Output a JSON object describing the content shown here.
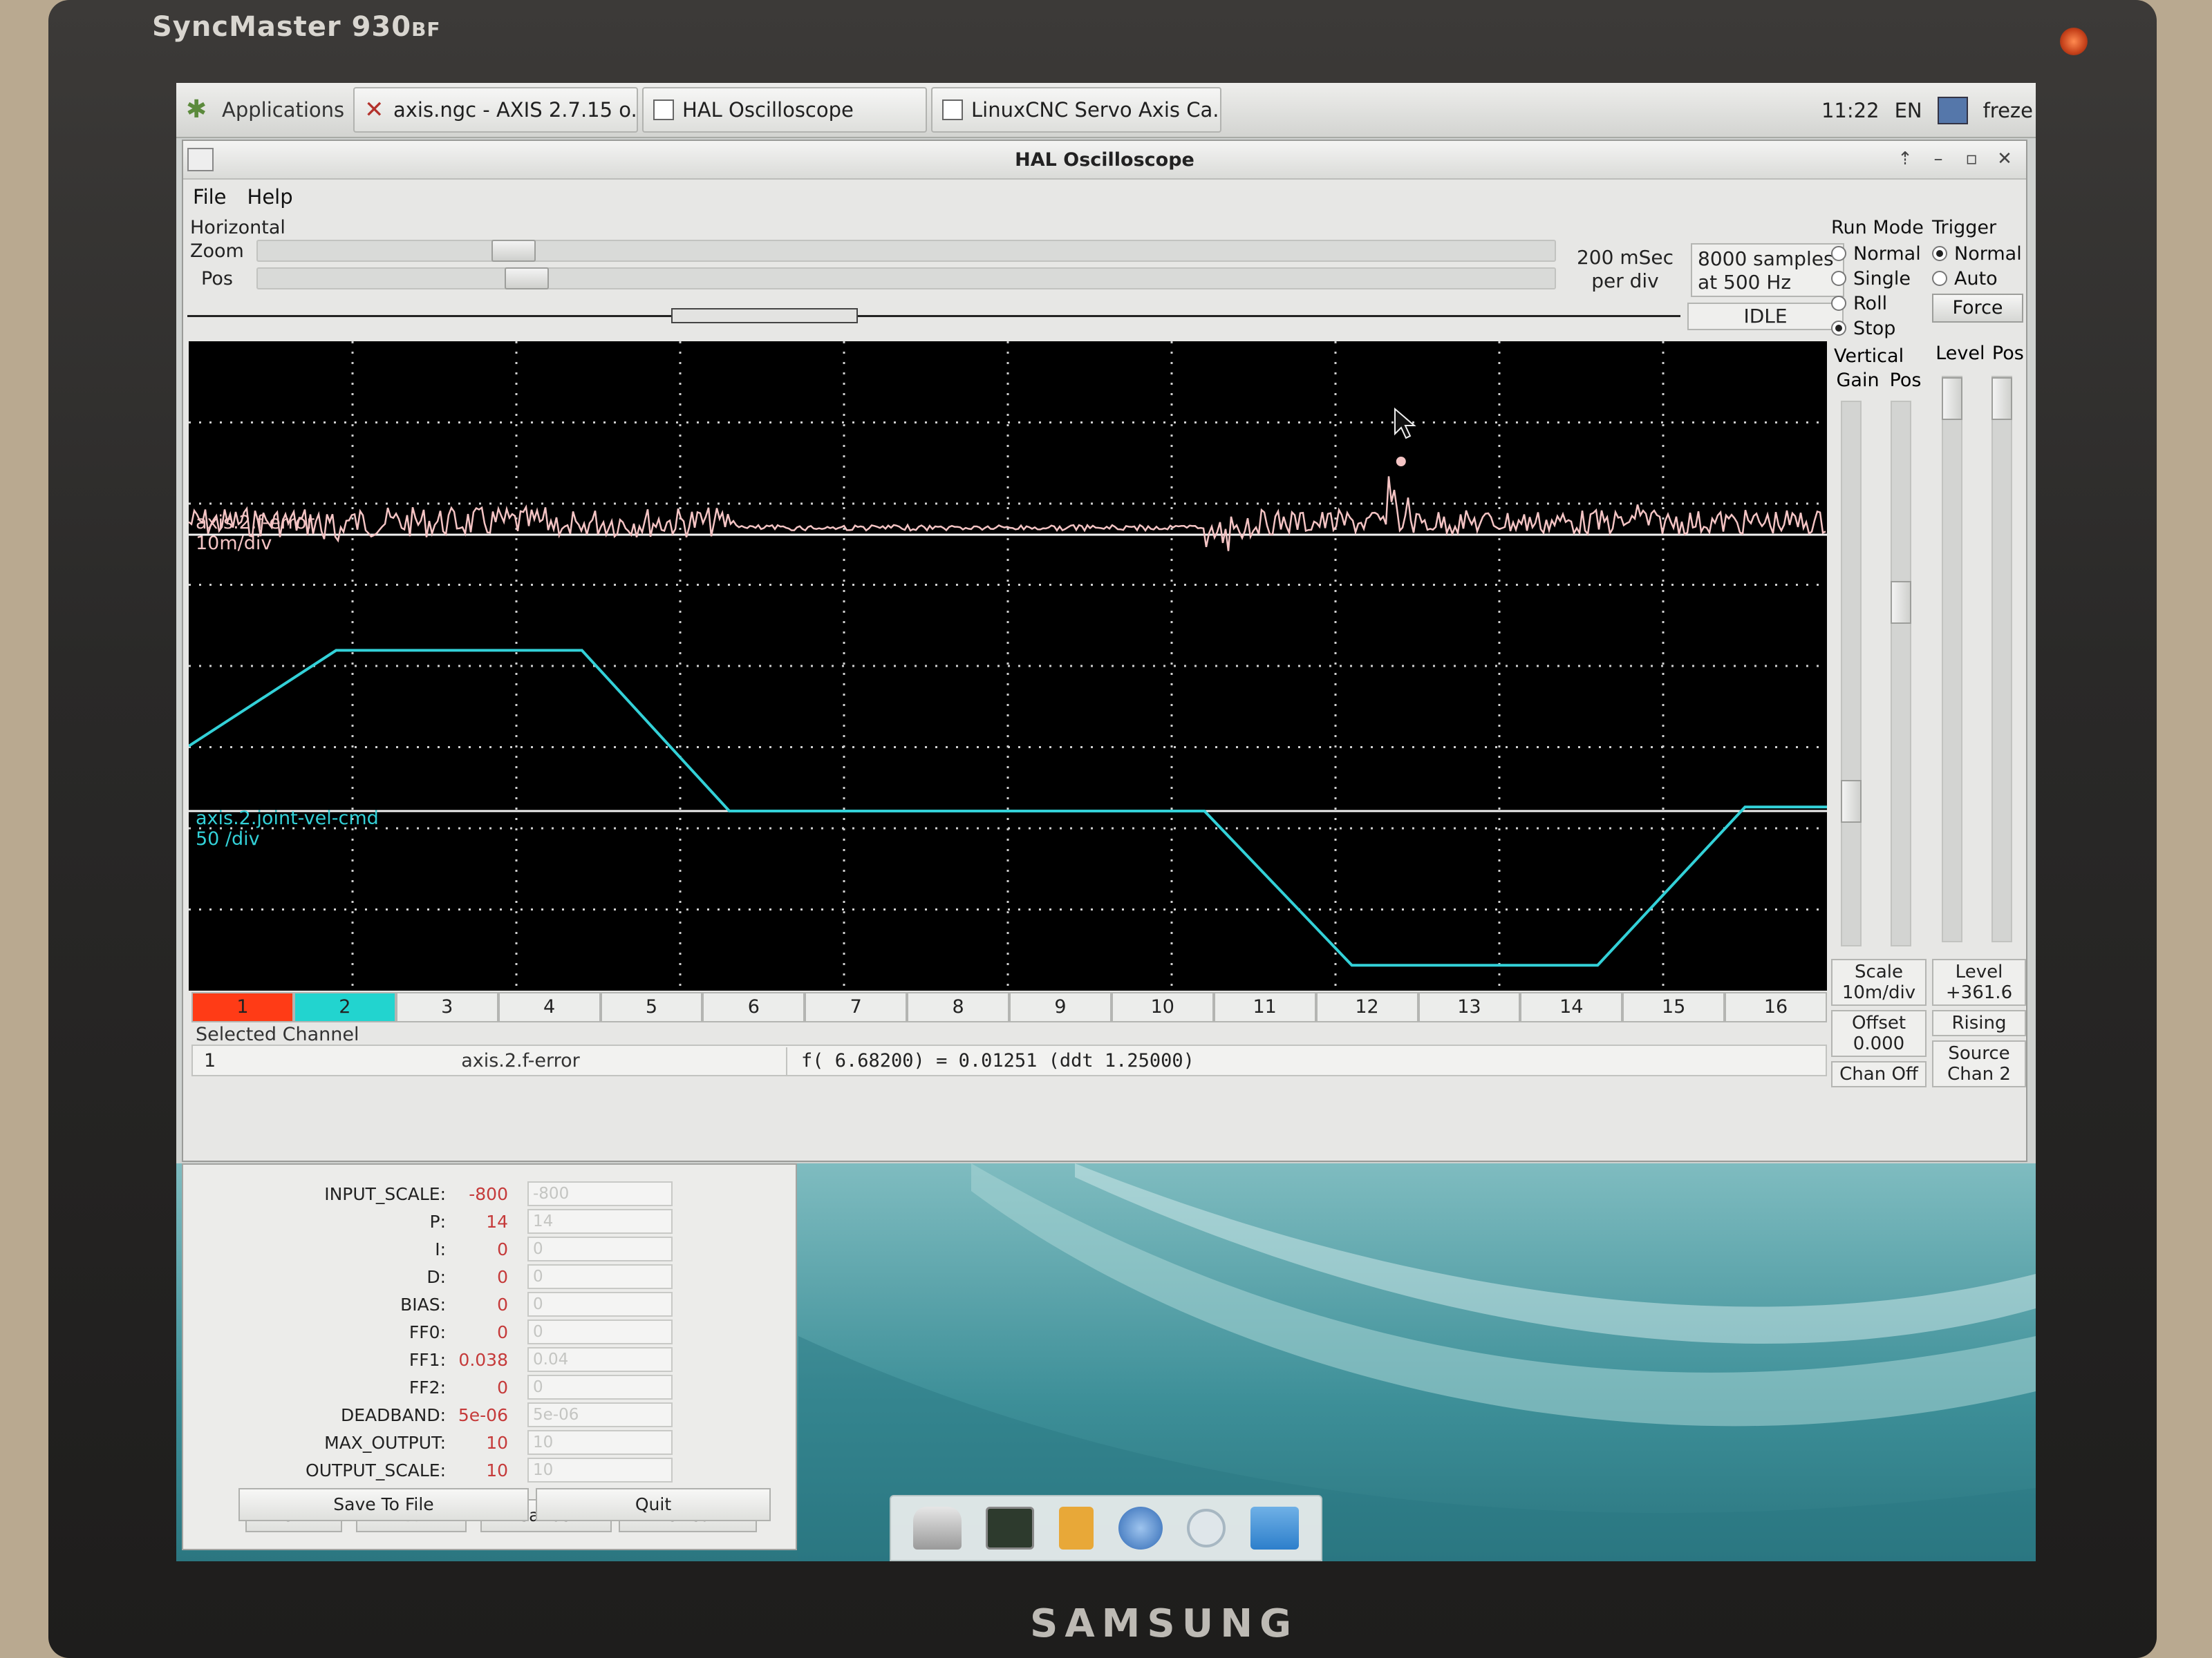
{
  "monitor": {
    "model": "SyncMaster 930",
    "model_suffix": "BF",
    "brand": "SAMSUNG"
  },
  "taskbar": {
    "apps_label": "Applications",
    "tasks": [
      "axis.ngc - AXIS 2.7.15 o...",
      "HAL Oscilloscope",
      "LinuxCNC Servo Axis Ca..."
    ],
    "clock": "11:22",
    "lang": "EN",
    "user": "freze"
  },
  "window": {
    "title": "HAL Oscilloscope",
    "menu": {
      "file": "File",
      "help": "Help"
    }
  },
  "horizontal": {
    "title": "Horizontal",
    "zoom_label": "Zoom",
    "pos_label": "Pos",
    "zoom_fraction": 0.18,
    "pos_fraction": 0.19,
    "per_div_line1": "200 mSec",
    "per_div_line2": "per div",
    "samples_line1": "8000 samples",
    "samples_line2": "at 500 Hz",
    "state": "IDLE"
  },
  "run_mode": {
    "title": "Run Mode",
    "options": [
      "Normal",
      "Single",
      "Roll",
      "Stop"
    ],
    "selected": "Stop"
  },
  "trigger": {
    "title": "Trigger",
    "options": [
      "Normal",
      "Auto"
    ],
    "selected": "Normal",
    "force": "Force",
    "level_label": "Level",
    "pos_label": "Pos"
  },
  "vertical": {
    "title": "Vertical",
    "gain_label": "Gain",
    "pos_label": "Pos",
    "gain_fraction": 0.24,
    "pos_fraction": 0.64
  },
  "vertical_bottom": {
    "scale_label": "Scale",
    "scale_value": "10m/div",
    "offset_label": "Offset",
    "offset_value": "0.000",
    "chan_off": "Chan Off"
  },
  "trigger_bottom": {
    "level_label": "Level",
    "level_value": "+361.6",
    "edge": "Rising",
    "source_label": "Source",
    "source_value": "Chan 2"
  },
  "scope": {
    "channel1": {
      "name": "axis.2.f-error",
      "scale": "10m/div",
      "color": "#f4c4c4"
    },
    "channel2": {
      "name": "axis.2.joint-vel-cmd",
      "scale": "50 /div",
      "color": "#33d1d8"
    }
  },
  "channels": [
    "1",
    "2",
    "3",
    "4",
    "5",
    "6",
    "7",
    "8",
    "9",
    "10",
    "11",
    "12",
    "13",
    "14",
    "15",
    "16"
  ],
  "selected_channel": {
    "label": "Selected Channel",
    "number": "1",
    "name": "axis.2.f-error",
    "readout": "f( 6.68200) =  0.01251 (ddt  1.25000)"
  },
  "servo": {
    "params": [
      {
        "name": "INPUT_SCALE:",
        "current": "-800",
        "input": "-800"
      },
      {
        "name": "P:",
        "current": "14",
        "input": "14"
      },
      {
        "name": "I:",
        "current": "0",
        "input": "0"
      },
      {
        "name": "D:",
        "current": "0",
        "input": "0"
      },
      {
        "name": "BIAS:",
        "current": "0",
        "input": "0"
      },
      {
        "name": "FF0:",
        "current": "0",
        "input": "0"
      },
      {
        "name": "FF1:",
        "current": "0.038",
        "input": "0.04"
      },
      {
        "name": "FF2:",
        "current": "0",
        "input": "0"
      },
      {
        "name": "DEADBAND:",
        "current": "5e-06",
        "input": "5e-06"
      },
      {
        "name": "MAX_OUTPUT:",
        "current": "10",
        "input": "10"
      },
      {
        "name": "OUTPUT_SCALE:",
        "current": "10",
        "input": "10"
      }
    ],
    "ok": "OK",
    "test": "Test",
    "cancel": "Cancel",
    "refresh": "Refresh",
    "save": "Save To File",
    "quit": "Quit"
  }
}
